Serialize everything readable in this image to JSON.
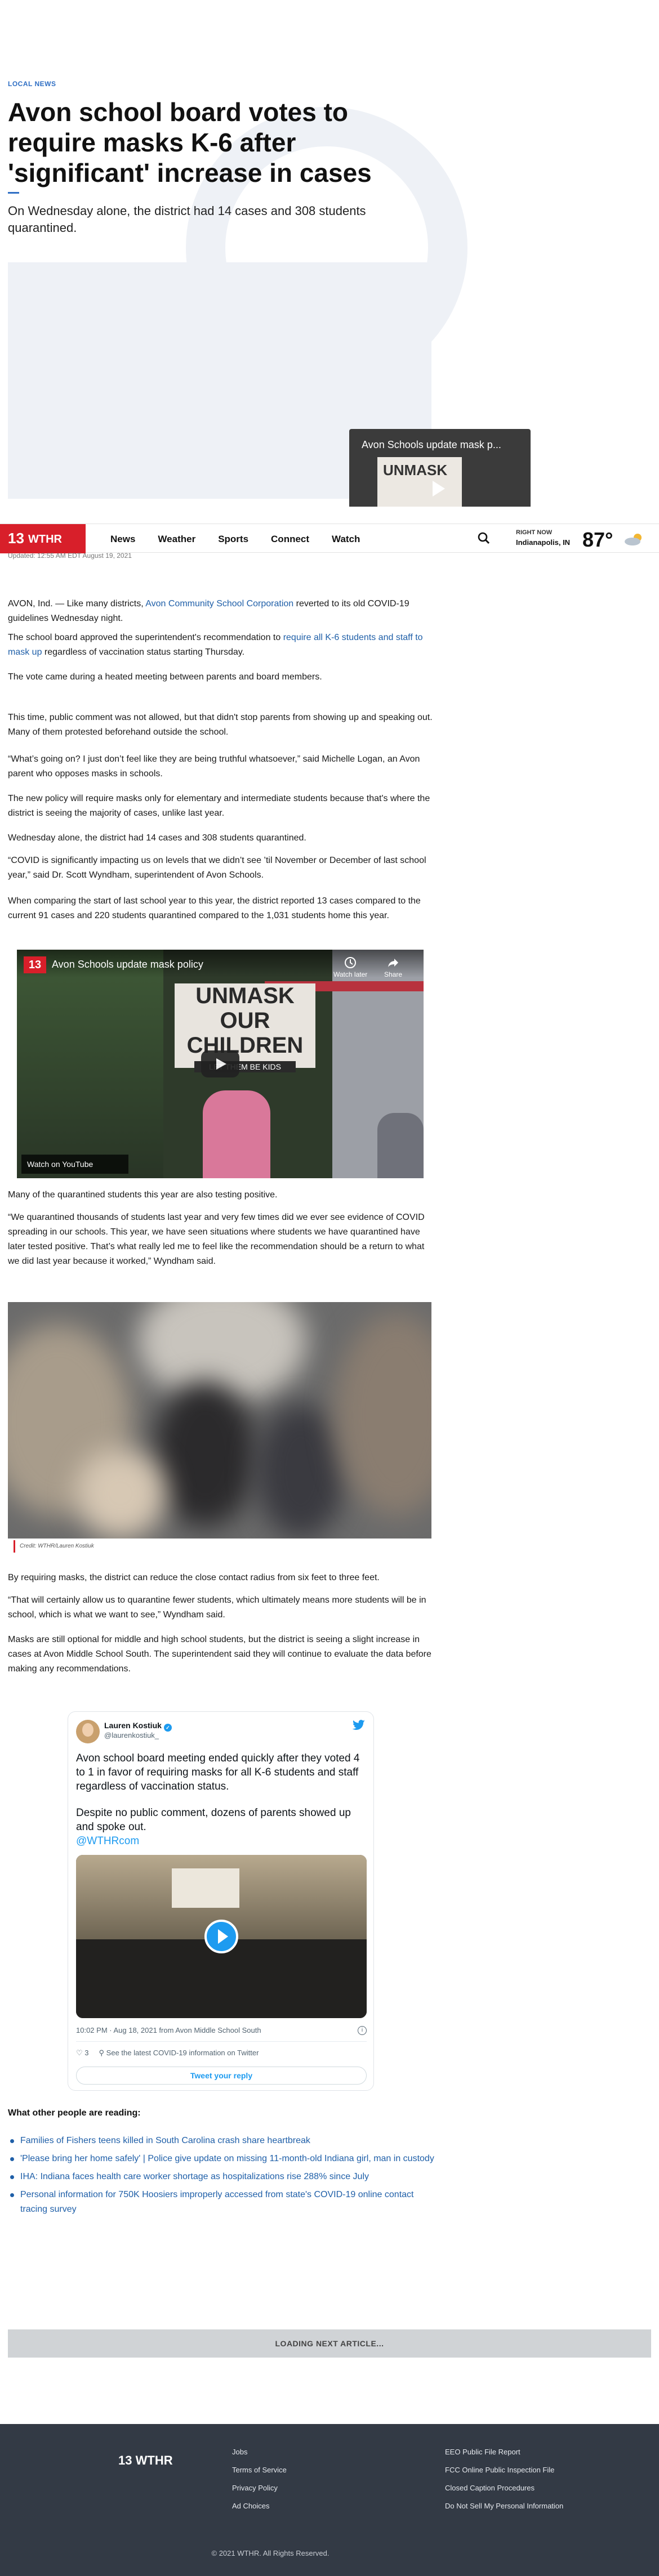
{
  "article": {
    "kicker": "LOCAL NEWS",
    "headline": "Avon school board votes to require masks K-6 after 'significant' increase in cases",
    "subhead": "On Wednesday alone, the district had 14 cases and 308 students quarantined.",
    "updated": "Updated: 12:55 AM EDT August 19, 2021"
  },
  "mini_player": {
    "title": "Avon Schools update mask p...",
    "sign_text": "UNMASK"
  },
  "nav": {
    "logo_number": "13",
    "logo_name": "WTHR",
    "items": [
      "News",
      "Weather",
      "Sports",
      "Connect",
      "Watch"
    ],
    "weather_label": "RIGHT NOW",
    "weather_location": "Indianapolis, IN",
    "temperature": "87°"
  },
  "body": {
    "p1_prefix": "AVON, Ind. — Like many districts, ",
    "p1_link": "Avon Community School Corporation",
    "p1_suffix": " reverted to its old COVID-19 guidelines Wednesday night.",
    "p2_prefix": "The school board approved the superintendent's recommendation to ",
    "p2_link": "require all K-6 students and staff to mask up",
    "p2_suffix": " regardless of vaccination status starting Thursday.",
    "p3": "The vote came during a heated meeting between parents and board members.",
    "p4": "This time, public comment was not allowed, but that didn't stop parents from showing up and speaking out. Many of them protested beforehand outside the school.",
    "p5": "“What’s going on? I just don’t feel like they are being truthful whatsoever,” said Michelle Logan, an Avon parent who opposes masks in schools.",
    "p6": "The new policy will require masks only for elementary and intermediate students because that's where the district is seeing the majority of cases, unlike last year.",
    "p7": "Wednesday alone, the district had 14 cases and 308 students quarantined.",
    "p8": "“COVID is significantly impacting us on levels that we didn’t see ’til November or December of last school year,” said Dr. Scott Wyndham, superintendent of Avon Schools.",
    "p9": "When comparing the start of last school year to this year, the district reported 13 cases compared to the current 91 cases and 220 students quarantined compared to the 1,031 students home this year.",
    "p10": "Many of the quarantined students this year are also testing positive.",
    "p11": "“We quarantined thousands of students last year and very few times did we ever see evidence of COVID spreading in our schools. This year, we have seen situations where students we have quarantined have later tested positive. That’s what really led me to feel like the recommendation should be a return to what we did last year because it worked,” Wyndham said.",
    "photo_credit": "Credit: WTHR/Lauren Kostiuk",
    "p12": "By requiring masks, the district can reduce the close contact radius from six feet to three feet.",
    "p13": "“That will certainly allow us to quarantine fewer students, which ultimately means more students will be in school, which is what we want to see,” Wyndham said.",
    "p14": "Masks are still optional for middle and high school students, but the district is seeing a slight increase in cases at Avon Middle School South. The superintendent said they will continue to evaluate the data before making any recommendations."
  },
  "video": {
    "badge": "13",
    "title": "Avon Schools update mask policy",
    "watch_later": "Watch later",
    "share": "Share",
    "watch_on": "Watch on YouTube",
    "sign_line1": "UNMASK",
    "sign_line2": "OUR CHILDREN",
    "sign_line3": "LET THEM BE KIDS"
  },
  "tweet": {
    "name": "Lauren Kostiuk",
    "handle": "@laurenkostiuk_",
    "text1": "Avon school board meeting ended quickly after they voted 4 to 1 in favor of requiring masks for all K-6 students and staff regardless of vaccination status.",
    "text2": "Despite no public comment, dozens of parents showed up and spoke out.",
    "link": "@WTHRcom",
    "meta": "10:02 PM · Aug 18, 2021 from Avon Middle School South",
    "likes": "3",
    "covid_info": "See the latest COVID-19 information on Twitter",
    "reply": "Tweet your reply"
  },
  "reading": {
    "title": "What other people are reading:",
    "items": [
      "Families of Fishers teens killed in South Carolina crash share heartbreak",
      "'Please bring her home safely' | Police give update on missing 11-month-old Indiana girl, man in custody",
      "IHA: Indiana faces health care worker shortage as hospitalizations rise 288% since July",
      "Personal information for 750K Hoosiers improperly accessed from state's COVID-19 online contact tracing survey"
    ]
  },
  "loading": "LOADING NEXT ARTICLE...",
  "footer": {
    "col1": [
      "Jobs",
      "Terms of Service",
      "Privacy Policy",
      "Ad Choices"
    ],
    "col2": [
      "EEO Public File Report",
      "FCC Online Public Inspection File",
      "Closed Caption Procedures",
      "Do Not Sell My Personal Information"
    ],
    "copyright": "© 2021 WTHR. All Rights Reserved."
  },
  "colors": {
    "brand_red": "#d81f2a",
    "link_blue": "#1f5fa8",
    "footer_bg": "#333a45",
    "twitter_blue": "#1d9bf0"
  }
}
